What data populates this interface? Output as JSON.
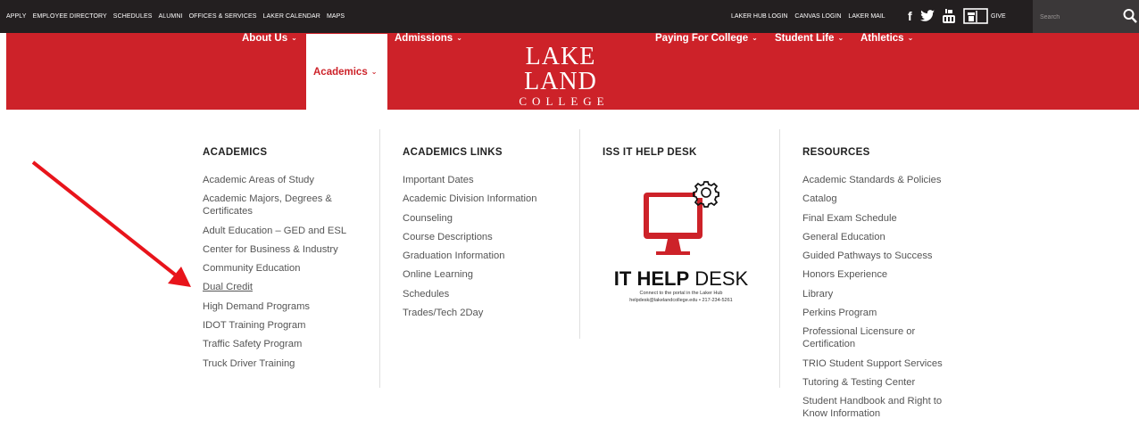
{
  "topbar": {
    "left_links": [
      "APPLY",
      "EMPLOYEE DIRECTORY",
      "SCHEDULES",
      "ALUMNI",
      "OFFICES & SERVICES",
      "LAKER CALENDAR",
      "MAPS"
    ],
    "right_links": [
      "LAKER HUB LOGIN",
      "CANVAS LOGIN",
      "LAKER MAIL"
    ],
    "social_icons": [
      "facebook-icon",
      "twitter-icon",
      "youtube-icon",
      "giving-icon"
    ],
    "give_label": "GIVE",
    "search_placeholder": "Search"
  },
  "nav": {
    "items": [
      {
        "label": "About Us",
        "active": false
      },
      {
        "label": "Academics",
        "active": true
      },
      {
        "label": "Admissions",
        "active": false
      },
      {
        "label": "Paying For College",
        "active": false
      },
      {
        "label": "Student Life",
        "active": false
      },
      {
        "label": "Athletics",
        "active": false
      }
    ],
    "logo_line1": "LAKE LAND",
    "logo_line2": "COLLEGE"
  },
  "menu": {
    "academics": {
      "heading": "ACADEMICS",
      "items": [
        "Academic Areas of Study",
        "Academic Majors, Degrees & Certificates",
        "Adult Education – GED and ESL",
        "Center for Business & Industry",
        "Community Education",
        "Dual Credit",
        "High Demand Programs",
        "IDOT Training Program",
        "Traffic Safety Program",
        "Truck Driver Training"
      ]
    },
    "links": {
      "heading": "ACADEMICS LINKS",
      "items": [
        "Important Dates",
        "Academic Division Information",
        "Counseling",
        "Course Descriptions",
        "Graduation Information",
        "Online Learning",
        "Schedules",
        "Trades/Tech 2Day"
      ]
    },
    "helpdesk": {
      "heading": "ISS IT HELP DESK",
      "title_bold": "IT HELP",
      "title_thin": "DESK",
      "subtitle1": "Connect to the portal in the Laker Hub",
      "subtitle2": "helpdesk@lakelandcollege.edu • 217-234-5261"
    },
    "resources": {
      "heading": "RESOURCES",
      "items": [
        "Academic Standards & Policies",
        "Catalog",
        "Final Exam Schedule",
        "General Education",
        "Guided Pathways to Success",
        "Honors Experience",
        "Library",
        "Perkins Program",
        "Professional Licensure or Certification",
        "TRIO Student Support Services",
        "Tutoring & Testing Center",
        "Student Handbook and Right to Know Information"
      ]
    }
  },
  "colors": {
    "brand_red": "#cd2229",
    "topbar": "#231f20",
    "annotation_arrow": "#e8141b"
  }
}
